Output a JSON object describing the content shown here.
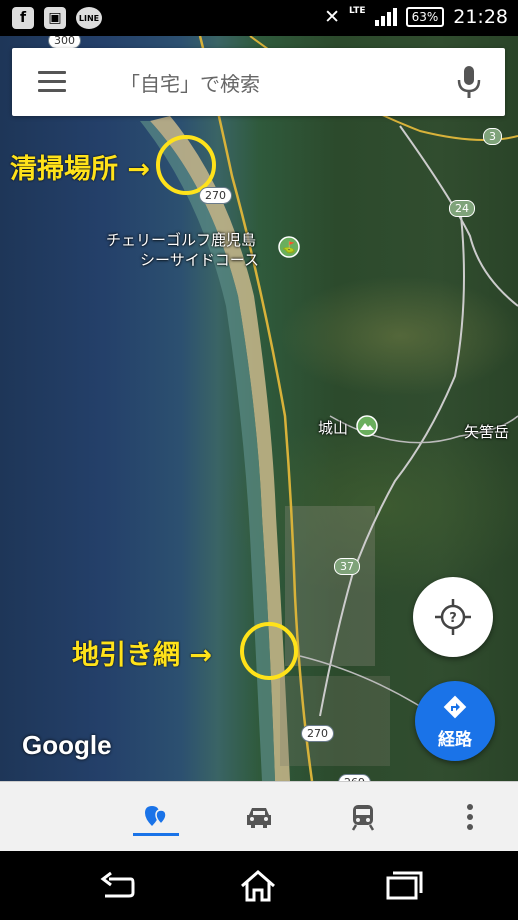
{
  "status_bar": {
    "left_icons": [
      "facebook-icon",
      "screenshot-icon",
      "line-icon"
    ],
    "line_label": "LINE",
    "network": "LTE",
    "battery": "63%",
    "time": "21:28"
  },
  "search": {
    "placeholder": "「自宅」で検索"
  },
  "map": {
    "places": {
      "golf_line1": "チェリーゴルフ鹿児島",
      "golf_line2": "シーサイドコース",
      "castle": "城山",
      "mountain": "矢筈岳"
    },
    "annotations": {
      "cleaning": "清掃場所 →",
      "net": "地引き網 →"
    },
    "road_shields": [
      "3",
      "24",
      "270",
      "37",
      "270",
      "269",
      "300"
    ],
    "logo": "Google"
  },
  "buttons": {
    "route_label": "経路"
  },
  "tabs": [
    {
      "name": "explore",
      "icon": "explore-pin-icon",
      "active": true
    },
    {
      "name": "driving",
      "icon": "car-icon",
      "active": false
    },
    {
      "name": "transit",
      "icon": "train-icon",
      "active": false
    },
    {
      "name": "more",
      "icon": "more-vertical-icon",
      "active": false
    }
  ],
  "nav_bar": [
    "back-icon",
    "home-icon",
    "recents-icon"
  ],
  "colors": {
    "accent": "#1a73e8",
    "annotation": "#ffe21a"
  }
}
